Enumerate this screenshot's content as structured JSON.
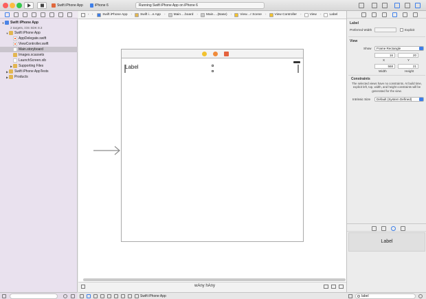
{
  "toolbar": {
    "scheme_project": "Swift iPhone App",
    "scheme_device": "iPhone 6",
    "status": "Running Swift iPhone App on iPhone 6"
  },
  "navigator": {
    "project": {
      "name": "Swift iPhone App",
      "subtitle": "2 targets, iOS SDK 8.3"
    },
    "items": [
      {
        "label": "Swift iPhone App",
        "kind": "folder",
        "indent": 1,
        "expanded": true
      },
      {
        "label": "AppDelegate.swift",
        "kind": "swift",
        "indent": 2
      },
      {
        "label": "ViewController.swift",
        "kind": "swift",
        "indent": 2
      },
      {
        "label": "Main.storyboard",
        "kind": "storyboard",
        "indent": 2,
        "selected": true
      },
      {
        "label": "Images.xcassets",
        "kind": "folder",
        "indent": 2
      },
      {
        "label": "LaunchScreen.xib",
        "kind": "storyboard",
        "indent": 2
      },
      {
        "label": "Supporting Files",
        "kind": "folder",
        "indent": 2,
        "expanded": false
      },
      {
        "label": "Swift iPhone AppTests",
        "kind": "folder",
        "indent": 1,
        "expanded": false
      },
      {
        "label": "Products",
        "kind": "folder",
        "indent": 1,
        "expanded": false
      }
    ]
  },
  "jumpbar": {
    "crumbs": [
      "Swift iPhone App",
      "Swift i…e App",
      "Main….board",
      "Main….(Base)",
      "View…r Scene",
      "View Controller",
      "View",
      "Label"
    ]
  },
  "canvas": {
    "label_text": "Label",
    "size_class": "wAny hAny"
  },
  "debugbar": {
    "target": "Swift iPhone App"
  },
  "inspector": {
    "label_section": {
      "title": "Label",
      "preferred_width_label": "Preferred Width",
      "explicit_label": "Explicit"
    },
    "view_section": {
      "title": "View",
      "show_label": "Show",
      "show_value": "Frame Rectangle",
      "x_value": "16",
      "y_value": "20",
      "x_label": "X",
      "y_label": "Y",
      "width_value": "568",
      "height_value": "21",
      "width_label": "Width",
      "height_label": "Height"
    },
    "constraints": {
      "title": "Constraints",
      "text": "The selected views have no constraints. At build time, explicit left, top, width, and height constraints will be generated for the view.",
      "intrinsic_label": "Intrinsic Size",
      "intrinsic_value": "Default (System Defined)"
    },
    "library_item": "Label",
    "filter_value": "label"
  },
  "colors": {
    "accent": "#3d7ee8",
    "navigator_bg": "#e9e1ee",
    "selected_row": "#c9c4cc"
  }
}
